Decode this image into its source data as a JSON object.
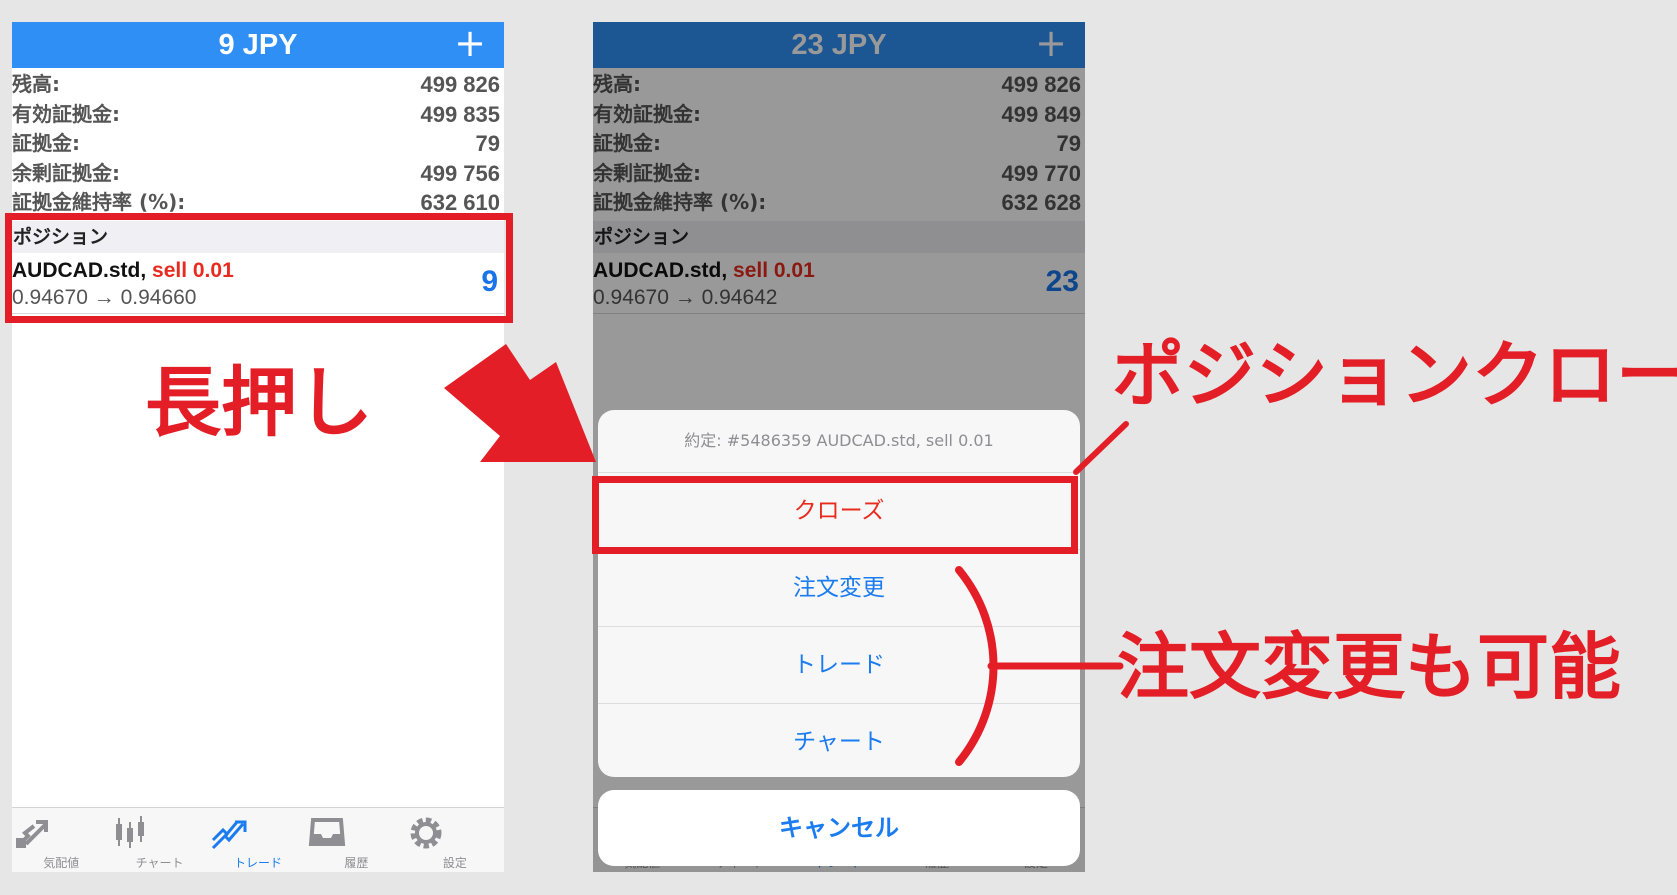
{
  "left": {
    "header": {
      "title": "9 JPY",
      "add_icon": "+"
    },
    "balance": [
      {
        "label": "残高:",
        "value": "499 826"
      },
      {
        "label": "有効証拠金:",
        "value": "499 835"
      },
      {
        "label": "証拠金:",
        "value": "79"
      },
      {
        "label": "余剰証拠金:",
        "value": "499 756"
      },
      {
        "label": "証拠金維持率 (%):",
        "value": "632 610"
      }
    ],
    "section": "ポジション",
    "position": {
      "symbol": "AUDCAD.std,",
      "side": "sell 0.01",
      "prices": "0.94670 → 0.94660",
      "profit": "9"
    }
  },
  "right": {
    "header": {
      "title": "23 JPY",
      "add_icon": "+"
    },
    "balance": [
      {
        "label": "残高:",
        "value": "499 826"
      },
      {
        "label": "有効証拠金:",
        "value": "499 849"
      },
      {
        "label": "証拠金:",
        "value": "79"
      },
      {
        "label": "余剰証拠金:",
        "value": "499 770"
      },
      {
        "label": "証拠金維持率 (%):",
        "value": "632 628"
      }
    ],
    "section": "ポジション",
    "position": {
      "symbol": "AUDCAD.std,",
      "side": "sell 0.01",
      "prices": "0.94670 → 0.94642",
      "profit": "23"
    },
    "action_sheet": {
      "title": "約定: #5486359 AUDCAD.std, sell 0.01",
      "actions": [
        "クローズ",
        "注文変更",
        "トレード",
        "チャート"
      ],
      "cancel": "キャンセル"
    }
  },
  "tabs": [
    {
      "label": "気配値",
      "icon": "quotes-icon"
    },
    {
      "label": "チャート",
      "icon": "chart-icon"
    },
    {
      "label": "トレード",
      "icon": "trade-icon"
    },
    {
      "label": "履歴",
      "icon": "history-icon"
    },
    {
      "label": "設定",
      "icon": "settings-icon"
    }
  ],
  "active_tab": "トレード",
  "annotations": {
    "long_press": "長押し",
    "position_close": "ポジションクローズ",
    "modify_possible": "注文変更も可能"
  },
  "colors": {
    "accent": "#2f8ff5",
    "annotation_red": "#e41e26",
    "sell_red": "#e82b1e",
    "profit_blue": "#1a73e8"
  }
}
